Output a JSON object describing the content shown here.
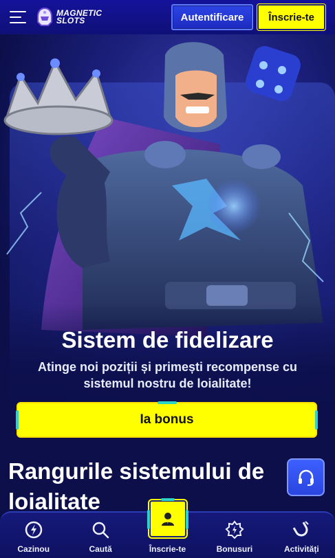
{
  "header": {
    "logo_line1": "MAGNETIC",
    "logo_line2": "SLOTS",
    "login_label": "Autentificare",
    "signup_label": "Înscrie-te"
  },
  "hero": {
    "title": "Sistem de fidelizare",
    "subtitle": "Atinge noi poziții și primești recompense cu sistemul nostru de loialitate!",
    "cta_label": "Ia bonus"
  },
  "ranks": {
    "title_line1": "Rangurile sistemului de",
    "title_line2": "loialitate"
  },
  "bottom_nav": {
    "items": [
      {
        "label": "Cazinou",
        "icon": "casino-chip-icon"
      },
      {
        "label": "Caută",
        "icon": "search-icon"
      },
      {
        "label": "Înscrie-te",
        "icon": "user-icon"
      },
      {
        "label": "Bonusuri",
        "icon": "bonus-badge-icon"
      },
      {
        "label": "Activități",
        "icon": "magnet-icon"
      }
    ]
  },
  "colors": {
    "background": "#0c0f4a",
    "header": "#14129a",
    "accent_yellow": "#ffff00",
    "accent_blue": "#2d45e6",
    "accent_teal": "#2ad4c8"
  }
}
